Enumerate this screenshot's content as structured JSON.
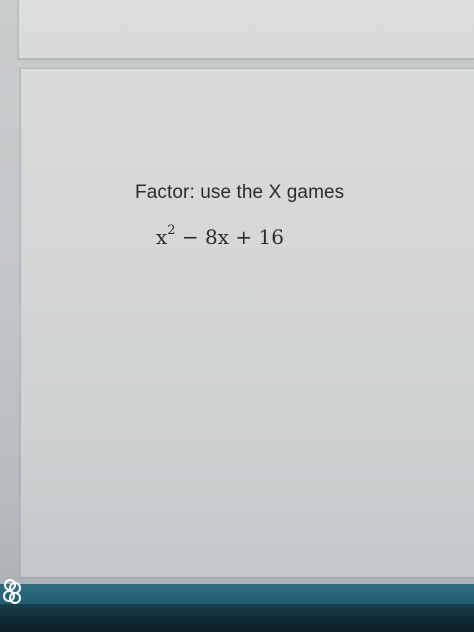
{
  "question": {
    "prompt": "Factor: use the X games",
    "expression_base": "x",
    "expression_exponent": "2",
    "expression_rest": " − 8x + 16"
  },
  "icons": {
    "corner_badge": "overlapping-shapes-icon"
  },
  "colors": {
    "card_background": "#d8dadb",
    "page_background": "#c3c6c8",
    "bottom_bar": "#1f5d70",
    "text": "#2a2c2e"
  }
}
